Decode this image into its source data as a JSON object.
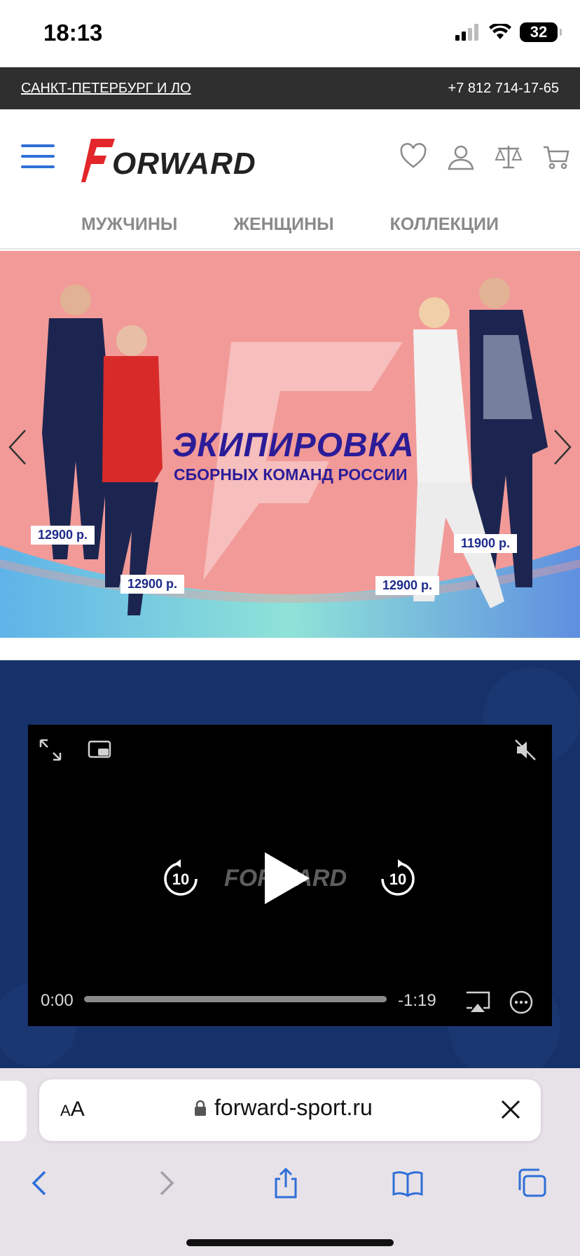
{
  "status": {
    "time": "18:13",
    "battery": "32"
  },
  "top_strip": {
    "city": "САНКТ-ПЕТЕРБУРГ И ЛО",
    "phone": "+7 812 714-17-65"
  },
  "header": {
    "logo_text": "ORWARD"
  },
  "nav": {
    "items": [
      "МУЖЧИНЫ",
      "ЖЕНЩИНЫ",
      "КОЛЛЕКЦИИ"
    ]
  },
  "banner": {
    "title": "ЭКИПИРОВКА",
    "subtitle": "СБОРНЫХ КОМАНД РОССИИ",
    "prices": [
      "12900 р.",
      "12900 р.",
      "12900 р.",
      "11900 р."
    ]
  },
  "video": {
    "logo_text": "FORWARD",
    "elapsed": "0:00",
    "remaining": "-1:19",
    "skip_back": "10",
    "skip_fwd": "10"
  },
  "safari": {
    "aa_label": "AA",
    "url": "forward-sport.ru"
  },
  "colors": {
    "accent": "#2f6fd8",
    "banner_bg": "#f29a98",
    "title_blue": "#2b1c98",
    "video_bg": "#17326a"
  }
}
